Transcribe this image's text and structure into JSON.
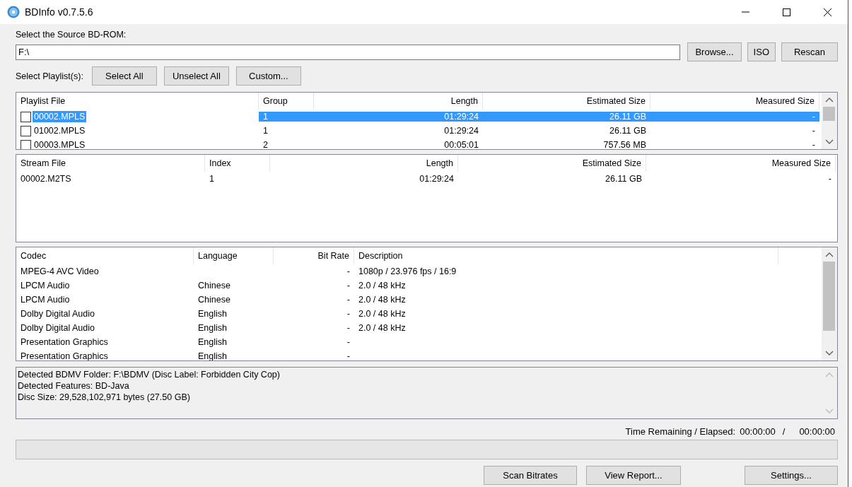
{
  "window": {
    "title": "BDInfo v0.7.5.6"
  },
  "source": {
    "label": "Select the Source BD-ROM:",
    "value": "F:\\",
    "buttons": [
      "Browse...",
      "ISO",
      "Rescan"
    ]
  },
  "playlist_select": {
    "label": "Select Playlist(s):",
    "buttons": [
      "Select All",
      "Unselect All",
      "Custom..."
    ]
  },
  "playlist_table": {
    "columns": [
      "Playlist File",
      "Group",
      "Length",
      "Estimated Size",
      "Measured Size"
    ],
    "rows": [
      {
        "cells": [
          "00002.MPLS",
          "1",
          "01:29:24",
          "26.11 GB",
          "-"
        ],
        "checked": false,
        "selected": true
      },
      {
        "cells": [
          "01002.MPLS",
          "1",
          "01:29:24",
          "26.11 GB",
          "-"
        ],
        "checked": false,
        "selected": false
      },
      {
        "cells": [
          "00003.MPLS",
          "2",
          "00:05:01",
          "757.56 MB",
          "-"
        ],
        "checked": false,
        "selected": false
      }
    ]
  },
  "stream_table": {
    "columns": [
      "Stream File",
      "Index",
      "Length",
      "Estimated Size",
      "Measured Size"
    ],
    "rows": [
      {
        "cells": [
          "00002.M2TS",
          "1",
          "01:29:24",
          "26.11 GB",
          "-"
        ]
      }
    ]
  },
  "codec_table": {
    "columns": [
      "Codec",
      "Language",
      "Bit Rate",
      "Description"
    ],
    "rows": [
      {
        "cells": [
          "MPEG-4 AVC Video",
          "",
          "-",
          "1080p / 23.976 fps / 16:9"
        ]
      },
      {
        "cells": [
          "LPCM Audio",
          "Chinese",
          "-",
          "2.0 / 48 kHz"
        ]
      },
      {
        "cells": [
          "LPCM Audio",
          "Chinese",
          "-",
          "2.0 / 48 kHz"
        ]
      },
      {
        "cells": [
          "Dolby Digital Audio",
          "English",
          "-",
          "2.0 / 48 kHz"
        ]
      },
      {
        "cells": [
          "Dolby Digital Audio",
          "English",
          "-",
          "2.0 / 48 kHz"
        ]
      },
      {
        "cells": [
          "Presentation Graphics",
          "English",
          "-",
          ""
        ]
      },
      {
        "cells": [
          "Presentation Graphics",
          "English",
          "-",
          ""
        ]
      }
    ]
  },
  "info_lines": [
    "Detected BDMV Folder: F:\\BDMV (Disc Label: Forbidden City Cop)",
    "Detected Features: BD-Java",
    "Disc Size: 29,528,102,971 bytes (27.50 GB)"
  ],
  "time": {
    "label": "Time Remaining / Elapsed:",
    "remaining": "00:00:00",
    "separator": "/",
    "elapsed": "00:00:00"
  },
  "progress": {
    "level": 0
  },
  "buttons": [
    "Scan Bitrates",
    "View Report...",
    "Settings..."
  ]
}
